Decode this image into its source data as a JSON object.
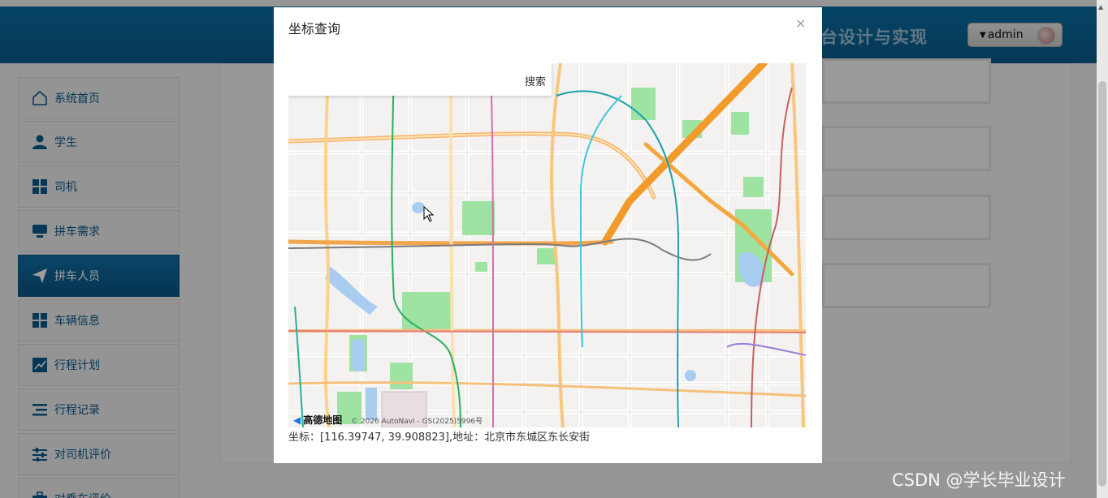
{
  "header": {
    "title": "台设计与实现",
    "user_label": "admin",
    "brand_color": "#0a5a8c"
  },
  "sidebar": {
    "items": [
      {
        "label": "系统首页",
        "icon": "home-icon"
      },
      {
        "label": "学生",
        "icon": "user-icon"
      },
      {
        "label": "司机",
        "icon": "grid-icon"
      },
      {
        "label": "拼车需求",
        "icon": "monitor-icon"
      },
      {
        "label": "拼车人员",
        "icon": "send-icon",
        "active": true
      },
      {
        "label": "车辆信息",
        "icon": "grid-icon"
      },
      {
        "label": "行程计划",
        "icon": "chart-icon"
      },
      {
        "label": "行程记录",
        "icon": "list-icon"
      },
      {
        "label": "对司机评价",
        "icon": "sliders-icon"
      },
      {
        "label": "对乘车评价",
        "icon": "briefcase-icon"
      }
    ]
  },
  "modal": {
    "title": "坐标查询",
    "close": "×",
    "search_placeholder": "",
    "search_button": "搜索",
    "map_logo": "高德地图",
    "map_copyright": "© 2026 AutoNavi - GS(2025)5996号",
    "coordinate_text": "坐标：[116.39747, 39.908823],地址：北京市东城区东长安街"
  },
  "watermark": "CSDN @学长毕业设计"
}
